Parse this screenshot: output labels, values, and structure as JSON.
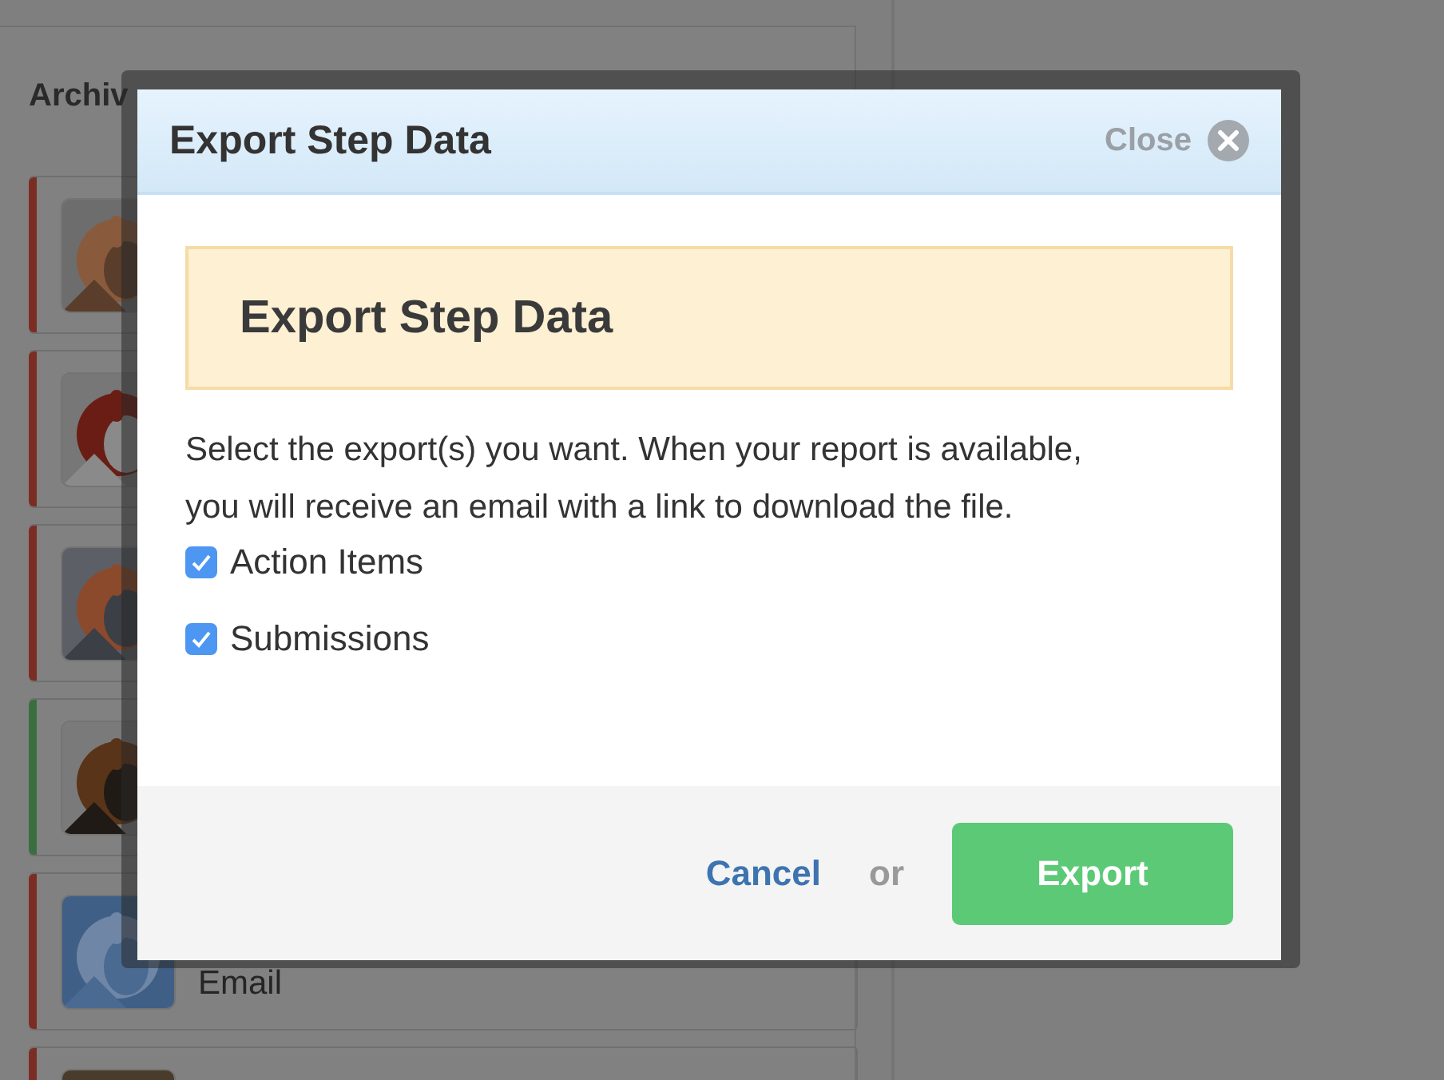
{
  "background": {
    "section_title": "Archiv",
    "cards": [
      {
        "color": "#7b2d24"
      },
      {
        "color": "#7b2d24"
      },
      {
        "color": "#7b2d24"
      },
      {
        "color": "#3a6e41"
      },
      {
        "color": "#7b2d24",
        "text": "Email"
      },
      {
        "color": "#7b2d24"
      }
    ]
  },
  "dialog": {
    "title": "Export Step Data",
    "close_label": "Close",
    "banner_title": "Export Step Data",
    "message": "Select the export(s) you want. When your report is available, you will receive an email with a link to download the file.",
    "options": [
      {
        "label": "Action Items",
        "checked": true
      },
      {
        "label": "Submissions",
        "checked": true
      }
    ],
    "cancel": "Cancel",
    "separator": "or",
    "submit": "Export"
  }
}
